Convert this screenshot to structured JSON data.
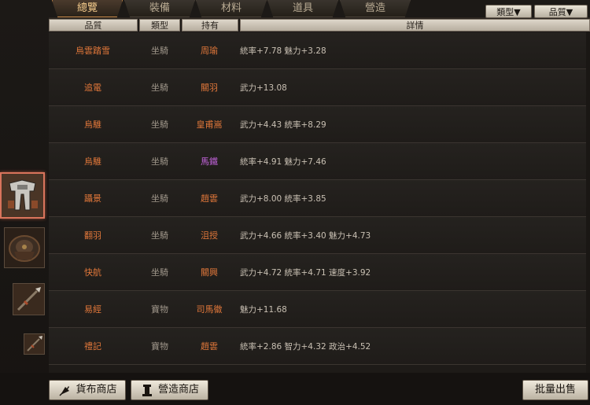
{
  "tabs": [
    {
      "label": "總覽",
      "active": true
    },
    {
      "label": "裝備",
      "active": false
    },
    {
      "label": "材料",
      "active": false
    },
    {
      "label": "道具",
      "active": false
    },
    {
      "label": "營造",
      "active": false
    }
  ],
  "filters": {
    "type_label": "類型▼",
    "quality_label": "品質▼"
  },
  "columns": {
    "quality": "品質",
    "type": "類型",
    "owner": "持有",
    "detail": "詳情"
  },
  "rows": [
    {
      "name": "烏雲踏雪",
      "type": "坐騎",
      "owner": "周瑜",
      "owner_color": "orange",
      "detail": "統率+7.78  魅力+3.28"
    },
    {
      "name": "追電",
      "type": "坐騎",
      "owner": "關羽",
      "owner_color": "orange",
      "detail": "武力+13.08"
    },
    {
      "name": "烏騅",
      "type": "坐騎",
      "owner": "皇甫嵩",
      "owner_color": "orange",
      "detail": "武力+4.43  統率+8.29"
    },
    {
      "name": "烏騅",
      "type": "坐騎",
      "owner": "馬鐵",
      "owner_color": "purple",
      "detail": "統率+4.91  魅力+7.46"
    },
    {
      "name": "躡景",
      "type": "坐騎",
      "owner": "趙雲",
      "owner_color": "orange",
      "detail": "武力+8.00  統率+3.85"
    },
    {
      "name": "翻羽",
      "type": "坐騎",
      "owner": "沮授",
      "owner_color": "orange",
      "detail": "武力+4.66  統率+3.40  魅力+4.73"
    },
    {
      "name": "快航",
      "type": "坐騎",
      "owner": "關興",
      "owner_color": "orange",
      "detail": "武力+4.72  統率+4.71  速度+3.92"
    },
    {
      "name": "易經",
      "type": "寶物",
      "owner": "司馬徽",
      "owner_color": "orange",
      "detail": "魅力+11.68"
    },
    {
      "name": "禮記",
      "type": "寶物",
      "owner": "趙雲",
      "owner_color": "orange",
      "detail": "統率+2.86  智力+4.32  政治+4.52"
    }
  ],
  "left_icons": [
    "armor-plate-icon",
    "shoulder-armor-icon",
    "spear-icon",
    "spear-small-icon"
  ],
  "bottom": {
    "currency_shop": "貨布商店",
    "build_shop": "營造商店",
    "bulk_sell": "批量出售"
  },
  "colors": {
    "accent_orange": "#e0773a",
    "purple": "#c062d8",
    "selected_border": "#d9745c"
  }
}
